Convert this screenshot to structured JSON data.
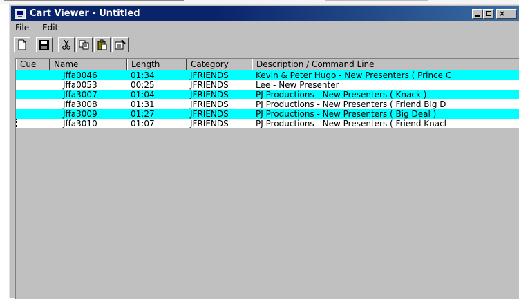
{
  "window": {
    "title": "Cart Viewer - Untitled",
    "controls": {
      "minimize": "_",
      "maximize": "□",
      "close": "×"
    }
  },
  "menu": {
    "file": "File",
    "edit": "Edit"
  },
  "toolbar": {
    "buttons": [
      "new-icon",
      "save-icon",
      "cut-icon",
      "copy-icon",
      "paste-icon",
      "properties-icon"
    ]
  },
  "list": {
    "headers": [
      "Cue",
      "Name",
      "Length",
      "Category",
      "Description / Command Line"
    ],
    "rows": [
      {
        "cue": "",
        "name": "Jffa0046",
        "length": "01:34",
        "category": "JFRIENDS",
        "description": "Kevin & Peter Hugo - New Presenters ( Prince C",
        "highlight": true
      },
      {
        "cue": "",
        "name": "Jffa0053",
        "length": "00:25",
        "category": "JFRIENDS",
        "description": "Lee - New Presenter",
        "highlight": false
      },
      {
        "cue": "",
        "name": "Jffa3007",
        "length": "01:04",
        "category": "JFRIENDS",
        "description": "PJ Productions - New Presenters ( Knack )",
        "highlight": true
      },
      {
        "cue": "",
        "name": "Jffa3008",
        "length": "01:31",
        "category": "JFRIENDS",
        "description": "PJ Productions - New Presenters ( Friend Big D",
        "highlight": false
      },
      {
        "cue": "",
        "name": "Jffa3009",
        "length": "01:27",
        "category": "JFRIENDS",
        "description": "PJ Productions - New Presenters ( Big Deal )",
        "highlight": true
      },
      {
        "cue": "",
        "name": "Jffa3010",
        "length": "01:07",
        "category": "JFRIENDS",
        "description": "PJ Productions - New Presenters ( Friend Knacl",
        "highlight": false
      }
    ]
  },
  "colors": {
    "titlebar": "#0a246a",
    "highlight_row": "#00ffff",
    "face": "#c0c0c0"
  }
}
